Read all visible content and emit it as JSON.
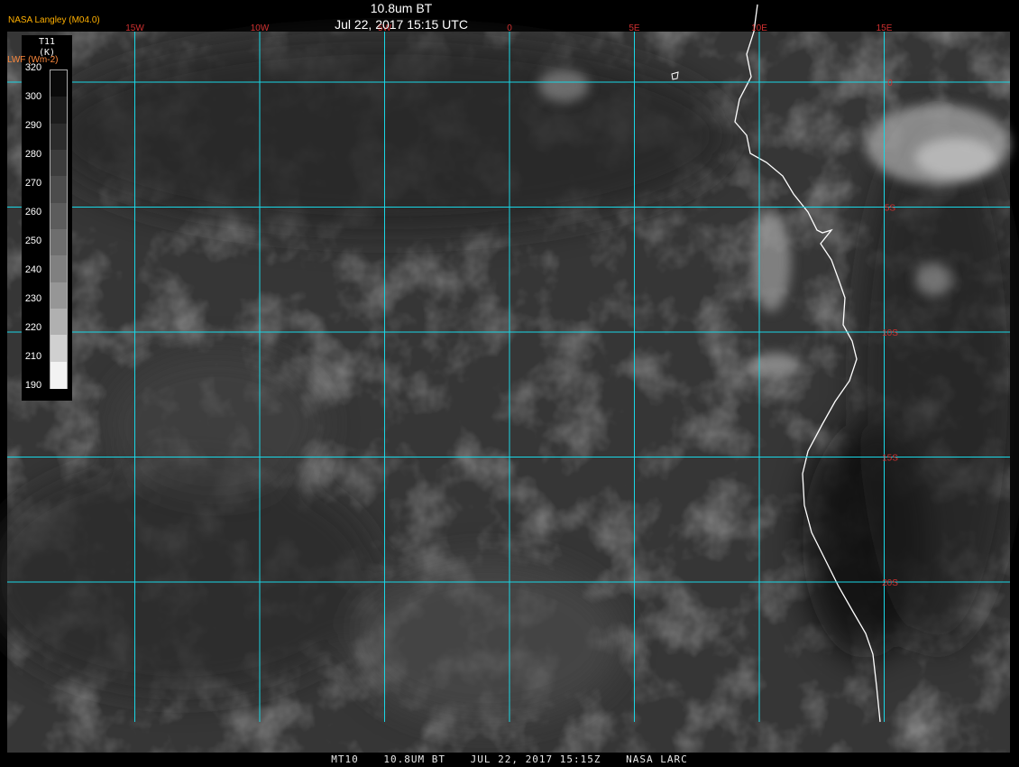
{
  "header": {
    "title": "10.8um BT",
    "subtitle": "Jul 22, 2017 15:15 UTC",
    "producer": "NASA Langley (M04.0)"
  },
  "colorbar": {
    "variable": "T11",
    "unit": "(K)",
    "overlay": "LWF (Wm-2)",
    "ticks": [
      "320",
      "300",
      "290",
      "280",
      "270",
      "260",
      "250",
      "240",
      "230",
      "220",
      "210",
      "190"
    ],
    "colors": [
      "#0a0a0a",
      "#1c1c1c",
      "#2c2c2c",
      "#3c3c3c",
      "#4c4c4c",
      "#5c5c5c",
      "#6e6e6e",
      "#808080",
      "#969696",
      "#b0b0b0",
      "#d0d0d0",
      "#f2f2f2"
    ]
  },
  "map": {
    "gridline_color": "#19d7e6",
    "coastline_color": "#ffffff",
    "label_color": "#d03030",
    "longitude_labels": [
      "15W",
      "10W",
      "5W",
      "0",
      "5E",
      "10E",
      "15E"
    ],
    "latitude_labels": [
      "0",
      "5S",
      "10S",
      "15S",
      "20S"
    ],
    "longitude_values": [
      -15,
      -10,
      -5,
      0,
      5,
      10,
      15
    ],
    "latitude_values": [
      0,
      -5,
      -10,
      -15,
      -20
    ]
  },
  "footer": {
    "satellite": "MT10",
    "channel": "10.8UM BT",
    "datetime": "JUL 22, 2017 15:15Z",
    "source": "NASA LARC"
  }
}
